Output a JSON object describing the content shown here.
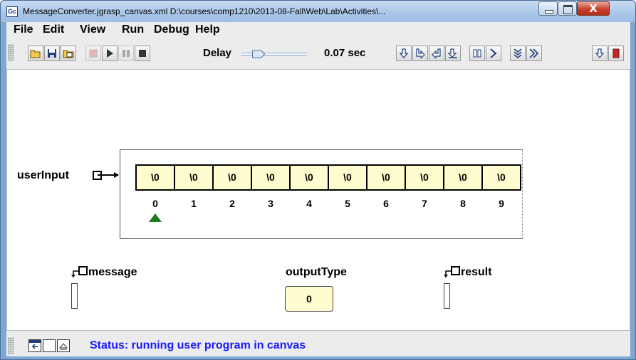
{
  "window": {
    "icon_text": "Gc",
    "title": "MessageConverter.jgrasp_canvas.xml  D:\\courses\\comp1210\\2013-08-Fall\\Web\\Lab\\Activities\\...",
    "close_glyph": "X"
  },
  "menu": [
    {
      "label": "File"
    },
    {
      "label": "Edit"
    },
    {
      "label": "View"
    },
    {
      "label": "Run"
    },
    {
      "label": "Debug"
    },
    {
      "label": "Help"
    }
  ],
  "toolbar": {
    "delay_label": "Delay",
    "delay_value": "0.07 sec",
    "delay_slider_fraction": 0.07,
    "icons": [
      "open-icon",
      "save-icon",
      "build-icon",
      "breakpoint-icon",
      "run-icon",
      "pause-icon",
      "stop-icon",
      "step-over-icon",
      "step-in-icon",
      "step-out-icon",
      "run-to-cursor-icon",
      "pause-all-icon",
      "step-all-icon",
      "step-into-all-icon",
      "fast-forward-icon",
      "down-arrow-icon",
      "terminate-icon"
    ]
  },
  "canvas": {
    "user_input": {
      "name": "userInput",
      "cells": [
        "\\0",
        "\\0",
        "\\0",
        "\\0",
        "\\0",
        "\\0",
        "\\0",
        "\\0",
        "\\0",
        "\\0"
      ],
      "indices": [
        "0",
        "1",
        "2",
        "3",
        "4",
        "5",
        "6",
        "7",
        "8",
        "9"
      ],
      "marked_index": 0
    },
    "message": {
      "name": "message"
    },
    "output_type": {
      "name": "outputType",
      "value": "0"
    },
    "result": {
      "name": "result"
    }
  },
  "status": {
    "text": "Status: running user program in canvas"
  },
  "colors": {
    "cell_fill": "#fffccf",
    "status_text": "#1a1aff",
    "index_marker": "#1f7a1f",
    "title_bar": "#a9c6e8"
  }
}
